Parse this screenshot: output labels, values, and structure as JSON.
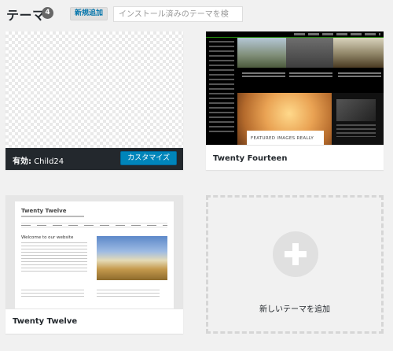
{
  "header": {
    "title": "テーマ",
    "count": "4",
    "add_new_label": "新規追加",
    "search_placeholder": "インストール済みのテーマを検索..."
  },
  "themes": [
    {
      "name": "Child24",
      "active": true,
      "active_prefix": "有効:",
      "customize_label": "カスタマイズ"
    },
    {
      "name": "Twenty Fourteen",
      "active": false,
      "screenshot_caption": "FEATURED IMAGES REALLY"
    },
    {
      "name": "Twenty Twelve",
      "active": false,
      "screenshot_title": "Twenty Twelve",
      "screenshot_heading": "Welcome to our website"
    }
  ],
  "add_new_theme": {
    "label": "新しいテーマを追加",
    "icon": "plus-icon"
  },
  "colors": {
    "active_bar": "#23282d",
    "primary_button": "#0085ba",
    "background": "#f1f1f1"
  }
}
